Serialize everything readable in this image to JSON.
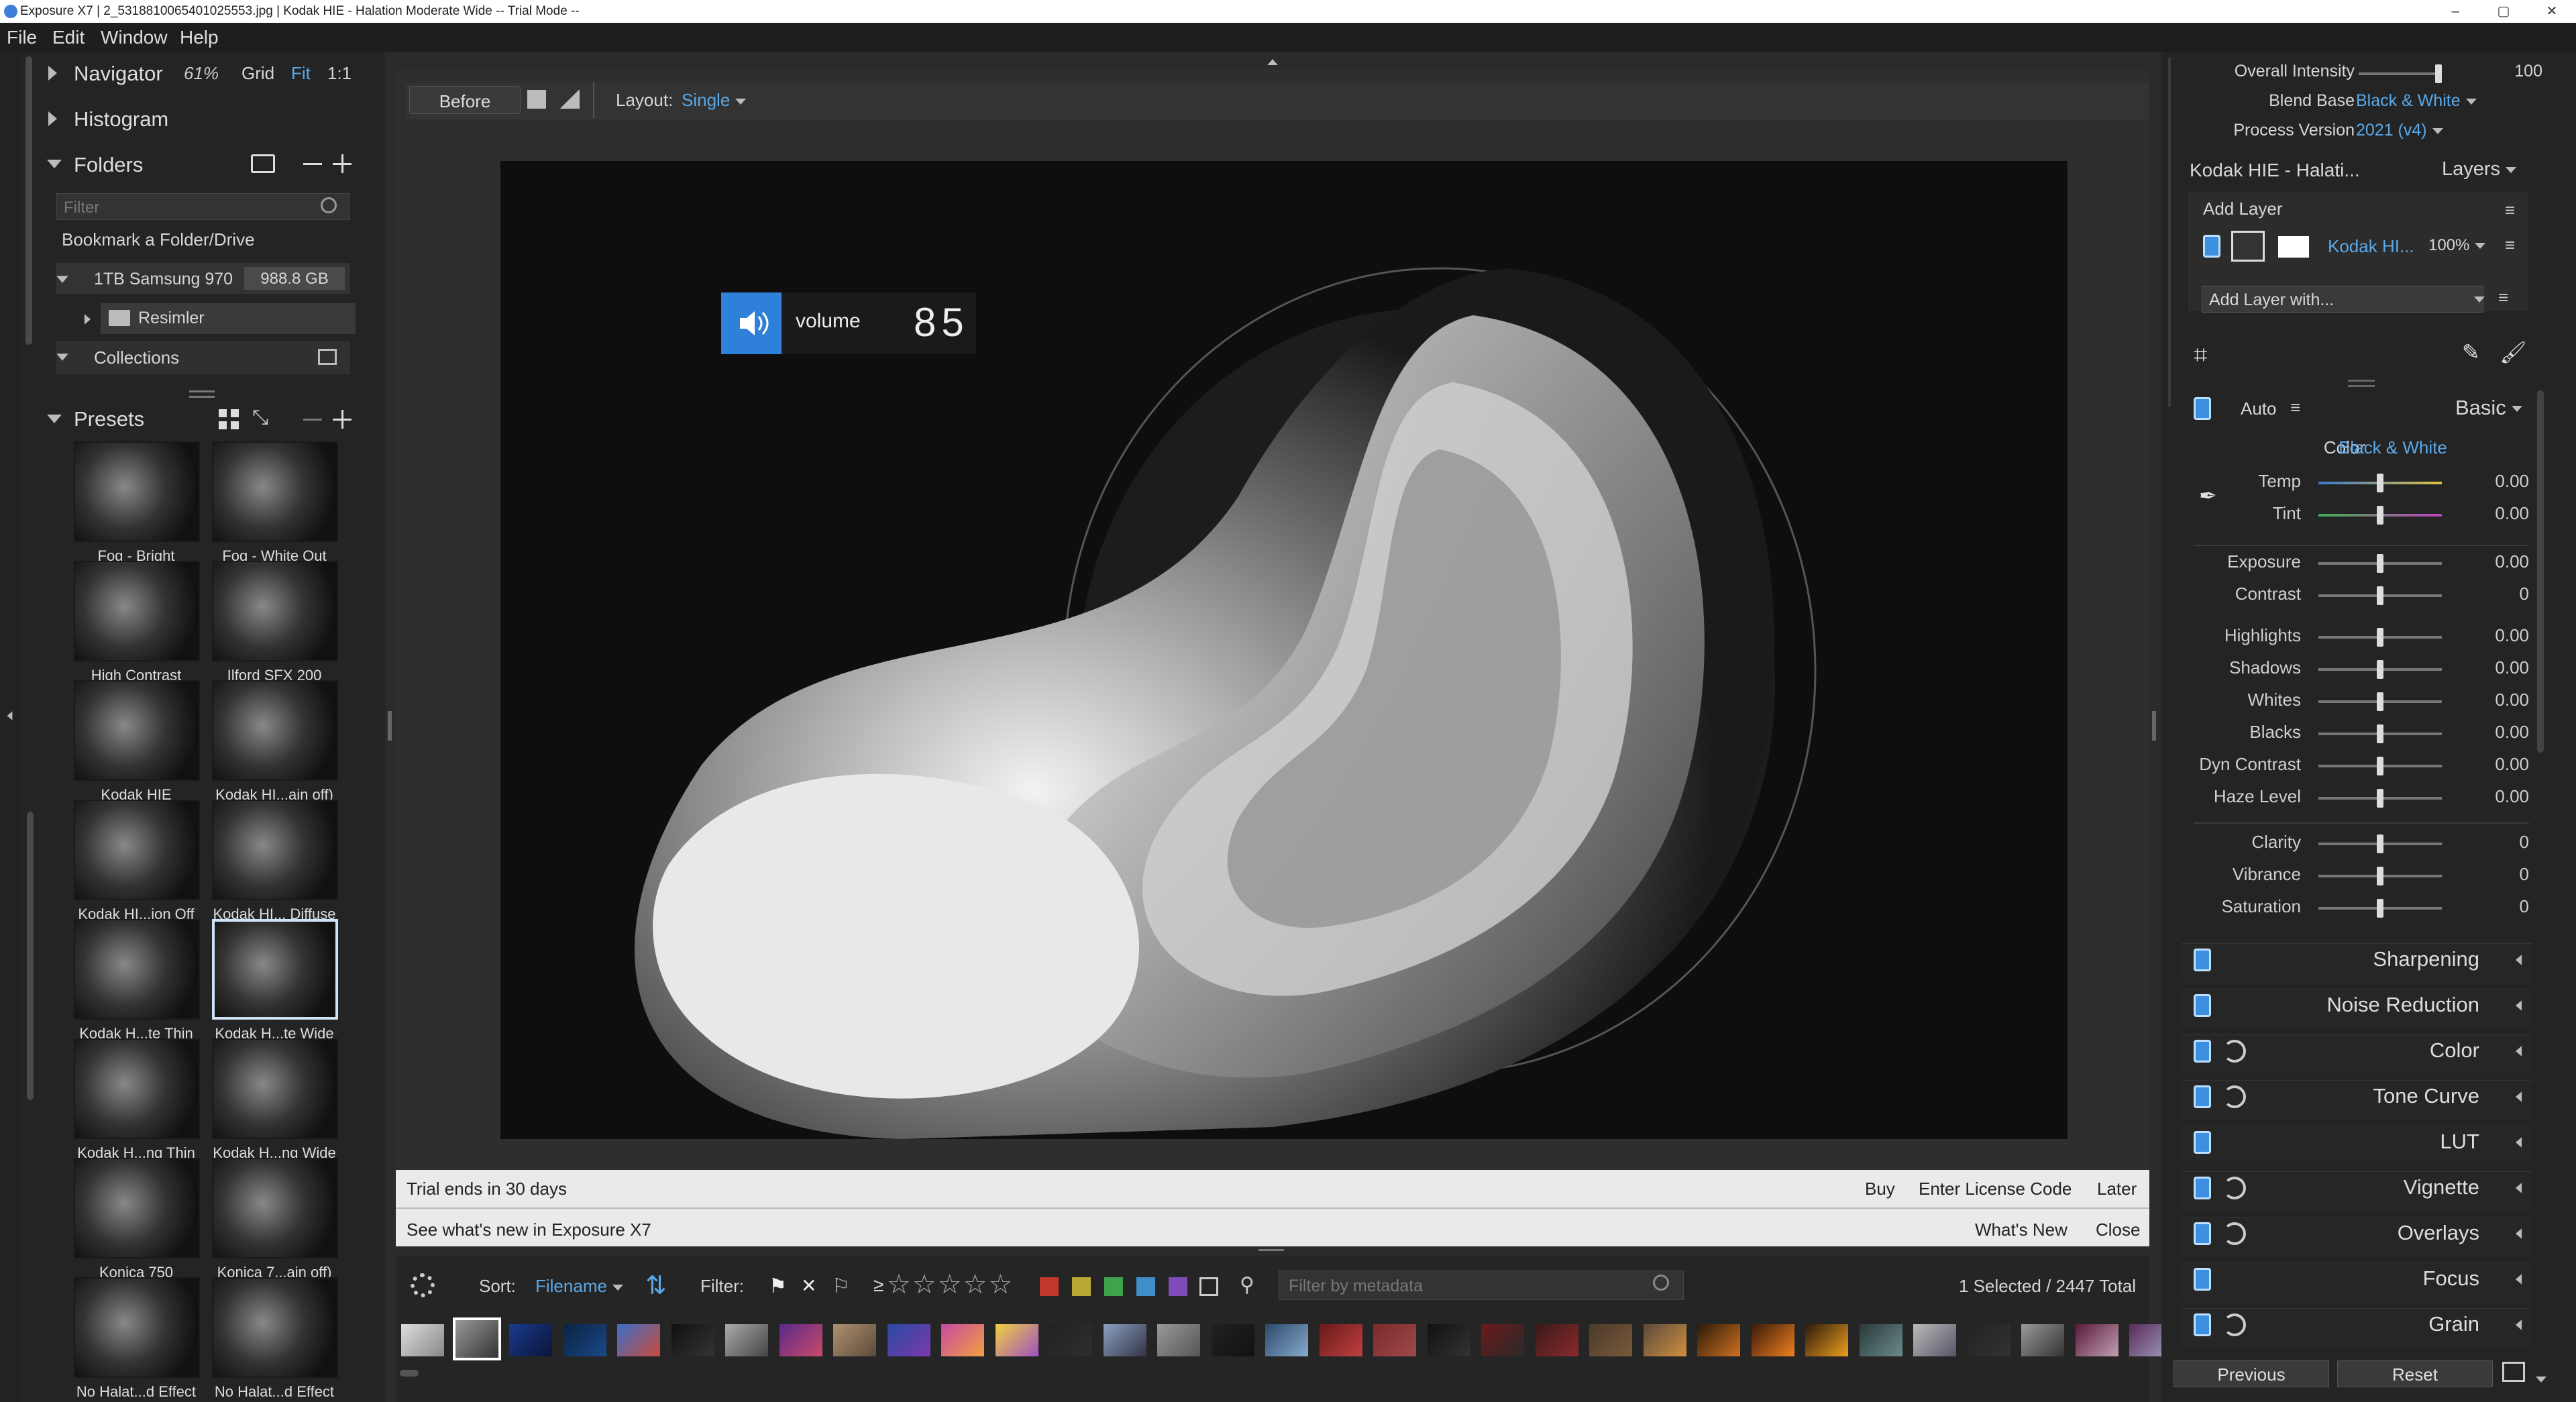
{
  "window": {
    "title": "Exposure X7 | 2_5318810065401025553.jpg | Kodak HIE - Halation Moderate Wide -- Trial Mode --",
    "minimize": "–",
    "maximize": "▢",
    "close": "✕"
  },
  "menu": [
    "File",
    "Edit",
    "Window",
    "Help"
  ],
  "navigator": {
    "label": "Navigator",
    "zoom": "61%",
    "grid": "Grid",
    "fit": "Fit",
    "one": "1:1"
  },
  "histogram": {
    "label": "Histogram"
  },
  "folders": {
    "label": "Folders",
    "filter_placeholder": "Filter",
    "bookmark": "Bookmark a Folder/Drive",
    "drive": "1TB Samsung 970",
    "drive_size": "988.8 GB",
    "subfolder": "Resimler",
    "collections": "Collections"
  },
  "presets": {
    "label": "Presets",
    "items": [
      "Fog - Bright",
      "Fog - White Out",
      "High Contrast",
      "Ilford SFX 200",
      "Kodak HIE",
      "Kodak HI...ain off)",
      "Kodak HI...ion  Off",
      "Kodak HI... Diffuse",
      "Kodak H...te Thin",
      "Kodak H...te Wide",
      "Kodak H...ng Thin",
      "Kodak H...ng Wide",
      "Konica 750",
      "Konica 7...ain off)",
      "No Halat...d Effect",
      "No Halat...d Effect"
    ],
    "selected_index": 9
  },
  "toolbar": {
    "before": "Before",
    "layout_label": "Layout:",
    "layout_value": "Single"
  },
  "volume": {
    "label": "volume",
    "value": "85"
  },
  "trial": {
    "message": "Trial ends in 30 days",
    "buy": "Buy",
    "license": "Enter License Code",
    "later": "Later",
    "whatsnew_msg": "See what's new in Exposure X7",
    "whatsnew": "What's New",
    "close": "Close"
  },
  "bottombar": {
    "sort_label": "Sort:",
    "sort_value": "Filename",
    "filter_label": "Filter:",
    "gte": "≥",
    "metadata_placeholder": "Filter by metadata",
    "selection": "1 Selected / 2447 Total",
    "color_filters": [
      "#c0392b",
      "#b9a835",
      "#3fa34d",
      "#3e8fc9",
      "#7d4cb8"
    ]
  },
  "right": {
    "overall_intensity_label": "Overall Intensity",
    "overall_intensity_value": "100",
    "overall_intensity": 1.0,
    "blend_base_label": "Blend Base",
    "blend_base_value": "Black & White",
    "process_label": "Process Version",
    "process_value": "2021 (v4)",
    "preset_name": "Kodak HIE - Halati...",
    "layers_label": "Layers",
    "add_layer": "Add Layer",
    "layer_name": "Kodak HI...",
    "layer_opacity": "100%",
    "add_layer_with": "Add Layer with...",
    "auto": "Auto",
    "basic": "Basic",
    "color_label": "Color",
    "color_value": "Black & White",
    "sliders": [
      {
        "label": "Temp",
        "value": "0.00"
      },
      {
        "label": "Tint",
        "value": "0.00"
      },
      {
        "label": "Exposure",
        "value": "0.00"
      },
      {
        "label": "Contrast",
        "value": "0"
      },
      {
        "label": "Highlights",
        "value": "0.00"
      },
      {
        "label": "Shadows",
        "value": "0.00"
      },
      {
        "label": "Whites",
        "value": "0.00"
      },
      {
        "label": "Blacks",
        "value": "0.00"
      },
      {
        "label": "Dyn Contrast",
        "value": "0.00"
      },
      {
        "label": "Haze Level",
        "value": "0.00"
      },
      {
        "label": "Clarity",
        "value": "0"
      },
      {
        "label": "Vibrance",
        "value": "0"
      },
      {
        "label": "Saturation",
        "value": "0"
      }
    ],
    "sections": [
      {
        "label": "Sharpening",
        "sync": false
      },
      {
        "label": "Noise Reduction",
        "sync": false
      },
      {
        "label": "Color",
        "sync": true
      },
      {
        "label": "Tone Curve",
        "sync": true
      },
      {
        "label": "LUT",
        "sync": false
      },
      {
        "label": "Vignette",
        "sync": true
      },
      {
        "label": "Overlays",
        "sync": true
      },
      {
        "label": "Focus",
        "sync": false
      },
      {
        "label": "Grain",
        "sync": true
      }
    ],
    "previous": "Previous",
    "reset": "Reset"
  },
  "accent": "#5aa9ea"
}
